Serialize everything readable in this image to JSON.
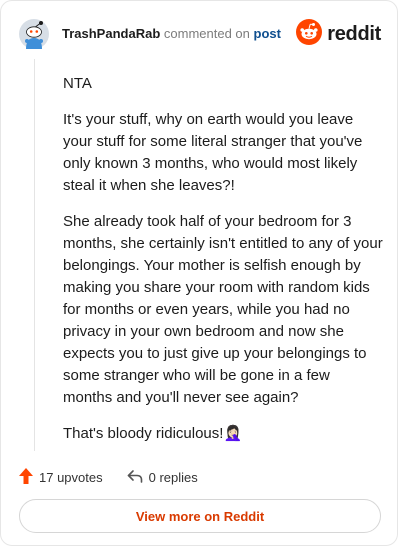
{
  "header": {
    "username": "TrashPandaRab",
    "commented_text": "commented on",
    "post_link": "post",
    "brand": "reddit"
  },
  "comment": {
    "paragraphs": [
      "NTA",
      "It's your stuff, why on earth would you leave your stuff for some literal stranger that you've only known 3 months, who would most likely steal it when she leaves?!",
      "She already took half of your bedroom for 3 months, she certainly isn't entitled to any of your belongings. Your mother is selfish enough by making you share your room with random kids for months or even years, while you had no privacy in your own bedroom and now she expects you to just give up your belongings to some stranger who will be gone in a few months and you'll never see again?",
      "That's bloody ridiculous!🤦🏻‍♀️"
    ]
  },
  "actions": {
    "upvotes": "17 upvotes",
    "replies": "0 replies"
  },
  "footer": {
    "view_more": "View more on Reddit"
  },
  "colors": {
    "brand_orange": "#ff4500",
    "link_blue": "#0f4f8f",
    "button_text": "#d93a00"
  },
  "icons": [
    "snoo-avatar-icon",
    "reddit-logo-icon",
    "upvote-arrow-icon",
    "reply-arrow-icon"
  ]
}
